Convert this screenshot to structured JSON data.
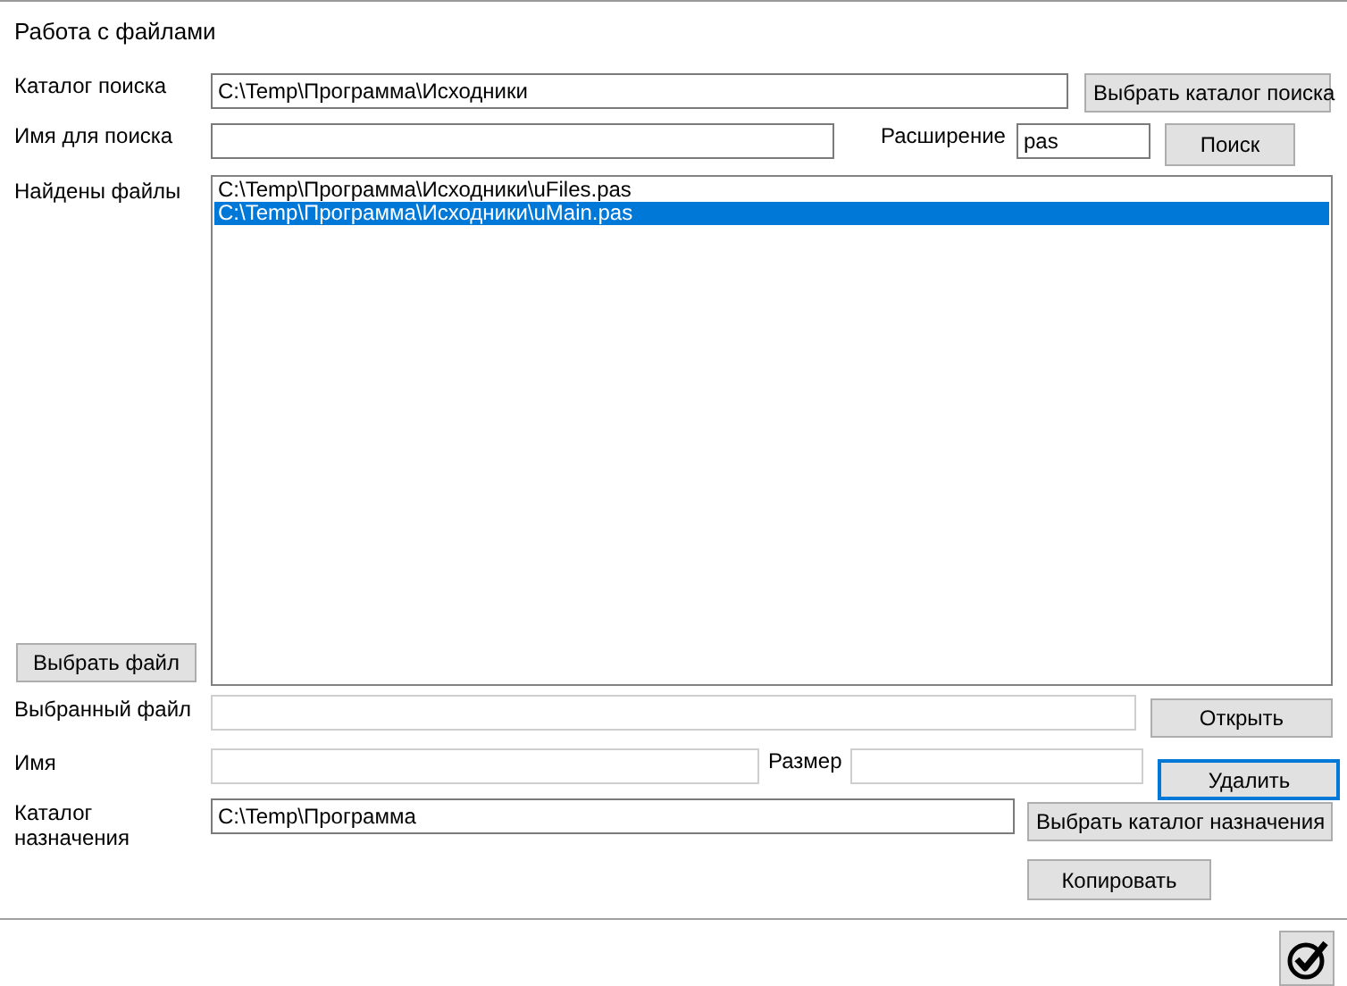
{
  "title": "Работа с файлами",
  "search_folder": {
    "label": "Каталог поиска",
    "value": "C:\\Temp\\Программа\\Исходники",
    "disabled": false,
    "button": {
      "label": "Выбрать каталог поиска",
      "focused": false
    }
  },
  "search_name": {
    "label": "Имя для поиска",
    "disabled": false
  },
  "extension": {
    "label": "Расширение",
    "value": "pas",
    "disabled": false
  },
  "search_button": {
    "label": "Поиск",
    "focused": false
  },
  "found_files": {
    "label": "Найдены файлы",
    "items": [
      {
        "path": "C:\\Temp\\Программа\\Исходники\\uFiles.pas",
        "selected": false
      },
      {
        "path": "C:\\Temp\\Программа\\Исходники\\uMain.pas",
        "selected": true
      }
    ],
    "button": {
      "label": "Выбрать файл",
      "focused": false
    }
  },
  "selected_file": {
    "label": "Выбранный файл",
    "disabled": true
  },
  "open_button": {
    "label": "Открыть",
    "focused": false
  },
  "name": {
    "label": "Имя",
    "disabled": true
  },
  "size": {
    "label": "Размер",
    "disabled": true
  },
  "delete_button": {
    "label": "Удалить",
    "focused": true
  },
  "destination": {
    "label": "Каталог назначения",
    "value": "C:\\Temp\\Программа",
    "disabled": false,
    "button": {
      "label": "Выбрать каталог назначения",
      "focused": false
    }
  },
  "copy_button": {
    "label": "Копировать",
    "focused": false
  }
}
